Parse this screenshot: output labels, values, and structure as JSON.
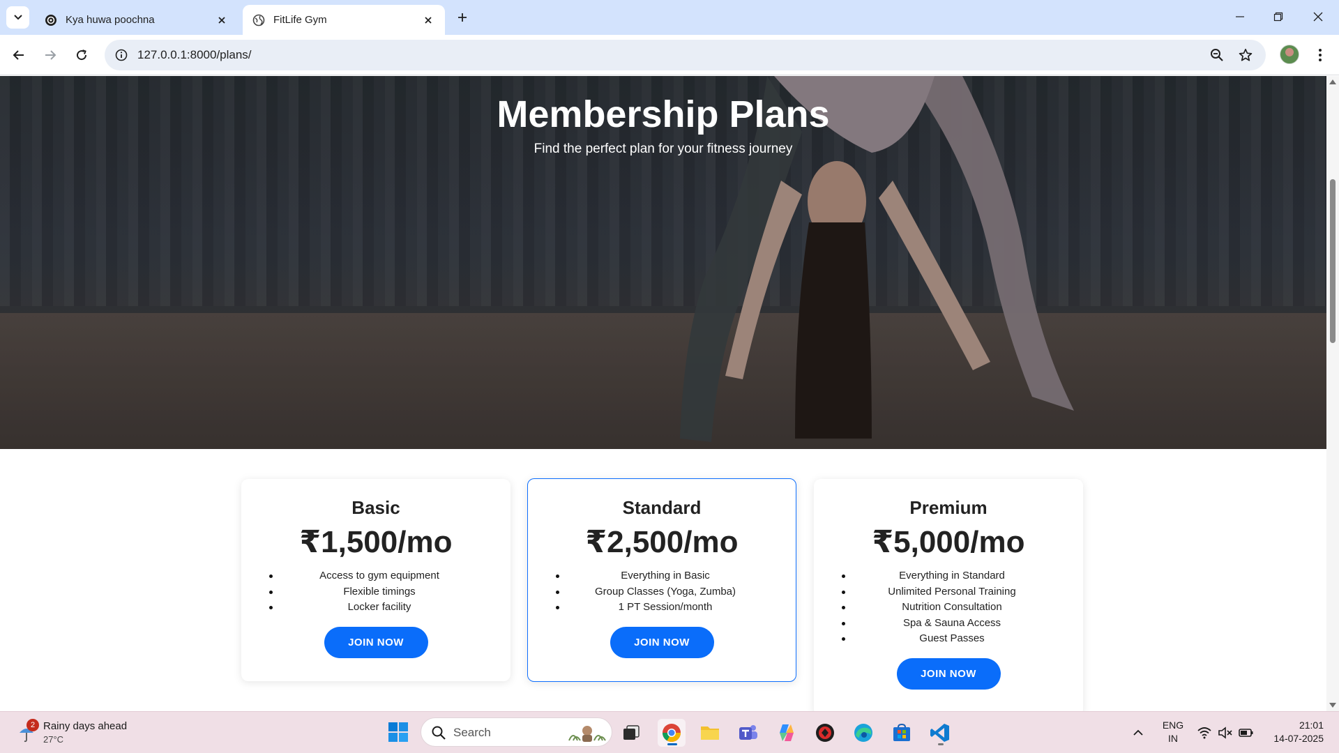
{
  "browser": {
    "tabs": [
      {
        "title": "Kya huwa poochna",
        "active": false
      },
      {
        "title": "FitLife Gym",
        "active": true
      }
    ],
    "url": "127.0.0.1:8000/plans/"
  },
  "hero": {
    "title": "Membership Plans",
    "subtitle": "Find the perfect plan for your fitness journey"
  },
  "plans": [
    {
      "name": "Basic",
      "price": "₹1,500/mo",
      "features": [
        "Access to gym equipment",
        "Flexible timings",
        "Locker facility"
      ],
      "cta": "JOIN NOW",
      "highlighted": false
    },
    {
      "name": "Standard",
      "price": "₹2,500/mo",
      "features": [
        "Everything in Basic",
        "Group Classes (Yoga, Zumba)",
        "1 PT Session/month"
      ],
      "cta": "JOIN NOW",
      "highlighted": true
    },
    {
      "name": "Premium",
      "price": "₹5,000/mo",
      "features": [
        "Everything in Standard",
        "Unlimited Personal Training",
        "Nutrition Consultation",
        "Spa & Sauna Access",
        "Guest Passes"
      ],
      "cta": "JOIN NOW",
      "highlighted": false
    }
  ],
  "taskbar": {
    "weather": {
      "badge": "2",
      "title": "Rainy days ahead",
      "temp": "27°C"
    },
    "search_label": "Search",
    "language": {
      "line1": "ENG",
      "line2": "IN"
    },
    "clock": {
      "time": "21:01",
      "date": "14-07-2025"
    }
  },
  "colors": {
    "accent": "#0a6dfa",
    "tabstrip": "#d3e3fd",
    "taskbar": "#f0dfe6"
  }
}
